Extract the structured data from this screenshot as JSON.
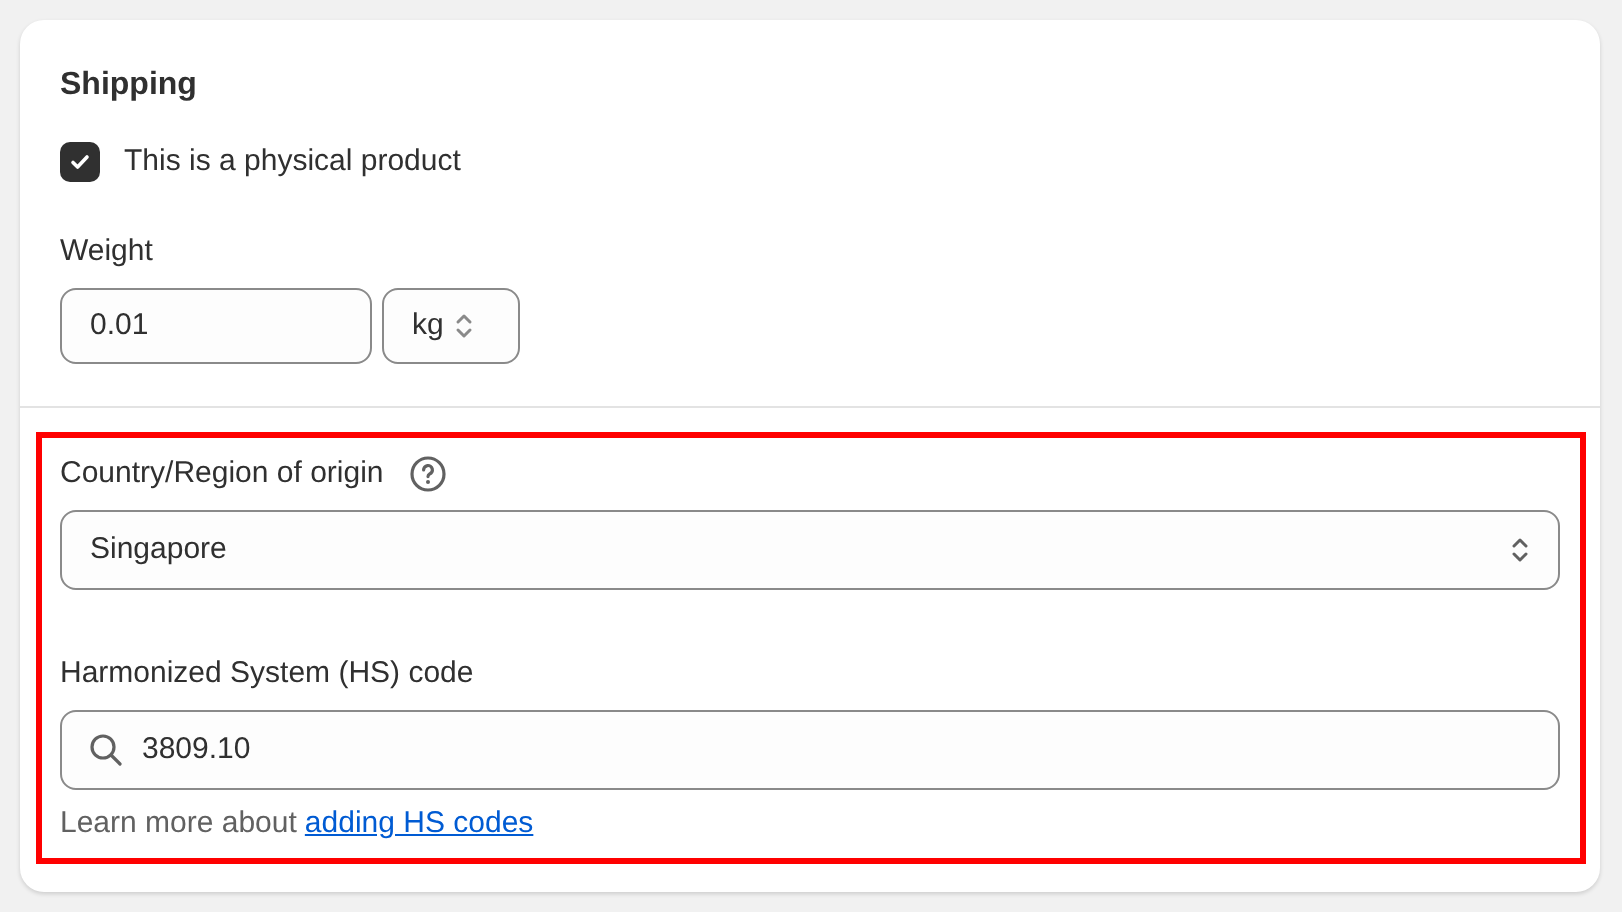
{
  "card": {
    "title": "Shipping",
    "physical_product": {
      "label": "This is a physical product",
      "checked": true
    },
    "weight": {
      "label": "Weight",
      "value": "0.01",
      "unit": "kg"
    },
    "country_of_origin": {
      "label": "Country/Region of origin",
      "value": "Singapore"
    },
    "hs_code": {
      "label": "Harmonized System (HS) code",
      "value": "3809.10",
      "help_text": "Learn more about",
      "help_link": "adding HS codes"
    }
  }
}
